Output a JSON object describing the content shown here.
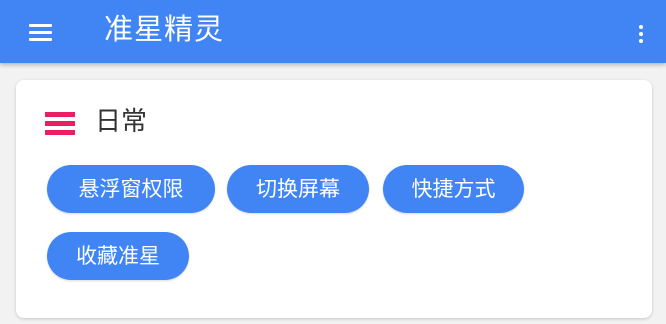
{
  "appbar": {
    "title": "准星精灵",
    "menu_icon": "hamburger-menu-icon",
    "more_icon": "more-vert-icon",
    "color": "#4185f4"
  },
  "section": {
    "title": "日常",
    "icon": "list-icon",
    "icon_color": "#e91e63",
    "chips": [
      {
        "label": "悬浮窗权限"
      },
      {
        "label": "切换屏幕"
      },
      {
        "label": "快捷方式"
      },
      {
        "label": "收藏准星"
      }
    ]
  }
}
